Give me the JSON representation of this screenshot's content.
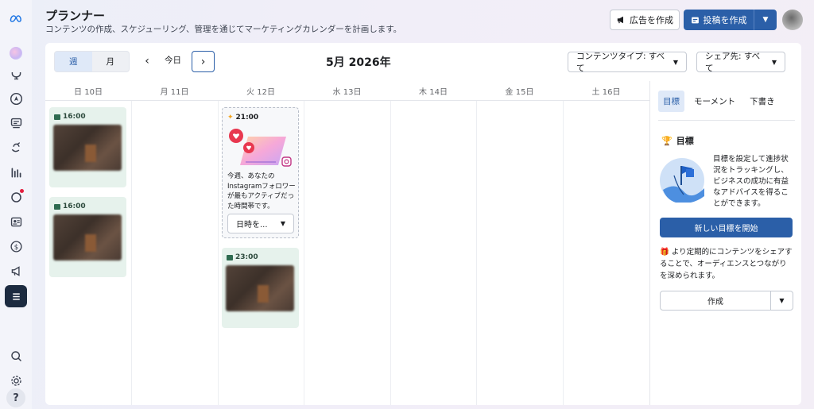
{
  "header": {
    "title": "プランナー",
    "subtitle": "コンテンツの作成、スケジューリング、管理を通じてマーケティングカレンダーを計画します。",
    "ad_button": "広告を作成",
    "post_button": "投稿を作成"
  },
  "rail": {
    "icons": [
      "meta-logo-icon",
      "profile-blob-icon",
      "notification-icon",
      "compass-icon",
      "content-icon",
      "inbox-icon",
      "insights-icon",
      "ads-icon",
      "monetization-icon",
      "megaphone-icon",
      "menu-icon",
      "search-icon",
      "gear-icon",
      "help-icon"
    ],
    "help_label": "?"
  },
  "toolbar": {
    "view_week": "週",
    "view_month": "月",
    "today": "今日",
    "month_label": "5月 2026年",
    "filter_content_type": "コンテンツタイプ: すべて",
    "filter_share": "シェア先: すべて"
  },
  "calendar": {
    "days": [
      "日 10日",
      "月 11日",
      "火 12日",
      "水 13日",
      "木 14日",
      "金 15日",
      "土 16日"
    ],
    "posts": [
      {
        "day": "日 10日",
        "time": "16:00"
      },
      {
        "day": "日 10日",
        "time": "16:00"
      },
      {
        "day": "火 12日",
        "time": "23:00"
      }
    ],
    "tip": {
      "time": "21:00",
      "text": "今週、あなたのInstagramフォロワーが最もアクティブだった時間帯です。",
      "select_label": "日時を..."
    }
  },
  "right_panel": {
    "tabs": [
      "目標",
      "モーメント",
      "下書き"
    ],
    "goal_title": "目標",
    "goal_text": "目標を設定して進捗状況をトラッキングし、ビジネスの成功に有益なアドバイスを得ることができます。",
    "new_goal_button": "新しい目標を開始",
    "share_text": "より定期的にコンテンツをシェアすることで、オーディエンスとつながりを深められます。",
    "create_button": "作成"
  },
  "colors": {
    "accent": "#2b5fa8",
    "post_bg": "#e6f2ec",
    "notification_dot": "#e41e3f"
  }
}
